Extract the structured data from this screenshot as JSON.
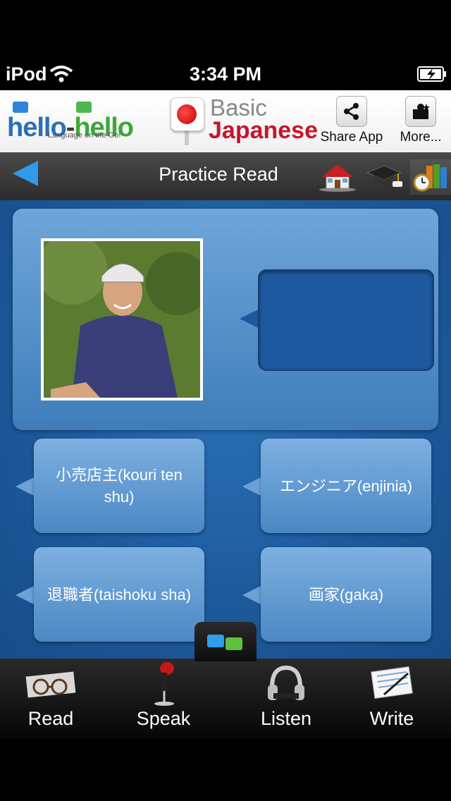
{
  "status_bar": {
    "carrier": "iPod",
    "time": "3:34 PM"
  },
  "header": {
    "logo_part1": "hello",
    "logo_dash": "-",
    "logo_part2": "hello",
    "logo_tagline": "Language on the Go!",
    "title_line1": "Basic",
    "title_line2": "Japanese",
    "share_label": "Share App",
    "more_label": "More..."
  },
  "nav": {
    "title": "Practice Read"
  },
  "choices": [
    {
      "label": "小売店主(kouri ten shu)"
    },
    {
      "label": "エンジニア(enjinia)"
    },
    {
      "label": "退職者(taishoku sha)"
    },
    {
      "label": "画家(gaka)"
    }
  ],
  "tabs": [
    {
      "label": "Read",
      "icon": "glasses-newspaper-icon"
    },
    {
      "label": "Speak",
      "icon": "microphone-icon"
    },
    {
      "label": "Listen",
      "icon": "headphones-icon"
    },
    {
      "label": "Write",
      "icon": "notebook-pen-icon"
    }
  ],
  "colors": {
    "accent_blue": "#2f9ae8",
    "title_red": "#c8152b",
    "content_blue": "#1d5a9c"
  }
}
